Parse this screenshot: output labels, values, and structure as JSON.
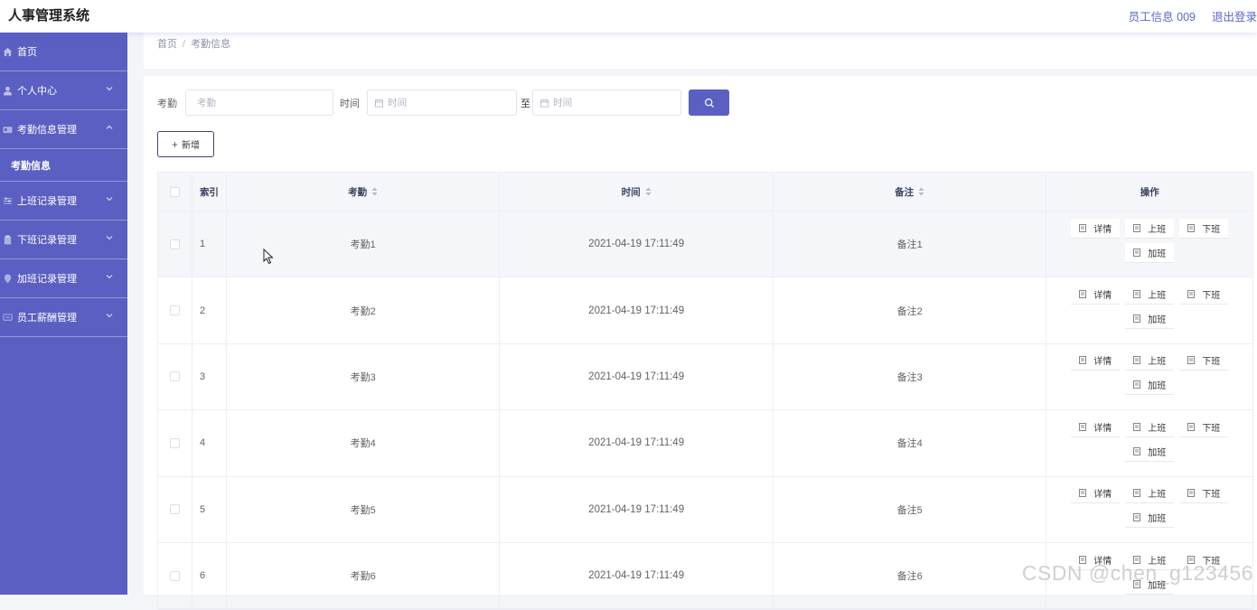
{
  "app": {
    "title": "人事管理系统",
    "user_label": "员工信息 009",
    "logout_label": "退出登录"
  },
  "sidebar": {
    "items": [
      {
        "label": "首页",
        "icon": "home-icon",
        "expandable": false
      },
      {
        "label": "个人中心",
        "icon": "user-icon",
        "expandable": true
      },
      {
        "label": "考勤信息管理",
        "icon": "card-icon",
        "expandable": true,
        "expanded": true,
        "children": [
          {
            "label": "考勤信息"
          }
        ]
      },
      {
        "label": "上班记录管理",
        "icon": "sliders-icon",
        "expandable": true
      },
      {
        "label": "下班记录管理",
        "icon": "clipboard-icon",
        "expandable": true
      },
      {
        "label": "加班记录管理",
        "icon": "pin-icon",
        "expandable": true
      },
      {
        "label": "员工薪酬管理",
        "icon": "message-icon",
        "expandable": true
      }
    ],
    "color": "#5b5fc2"
  },
  "breadcrumb": {
    "home": "首页",
    "separator": "/",
    "current": "考勤信息"
  },
  "search": {
    "attendance_label": "考勤",
    "attendance_placeholder": "考勤",
    "time_label": "时间",
    "time_start_placeholder": "时间",
    "to_label": "至",
    "time_end_placeholder": "时间",
    "search_icon": "search-icon"
  },
  "toolbar": {
    "add_label": "新增"
  },
  "table": {
    "headers": {
      "index": "索引",
      "attendance": "考勤",
      "time": "时间",
      "note": "备注",
      "actions": "操作"
    },
    "actions": {
      "detail": "详情",
      "clock_in": "上班",
      "clock_out": "下班",
      "overtime": "加班"
    },
    "rows": [
      {
        "index": "1",
        "attendance": "考勤1",
        "time": "2021-04-19 17:11:49",
        "note": "备注1"
      },
      {
        "index": "2",
        "attendance": "考勤2",
        "time": "2021-04-19 17:11:49",
        "note": "备注2"
      },
      {
        "index": "3",
        "attendance": "考勤3",
        "time": "2021-04-19 17:11:49",
        "note": "备注3"
      },
      {
        "index": "4",
        "attendance": "考勤4",
        "time": "2021-04-19 17:11:49",
        "note": "备注4"
      },
      {
        "index": "5",
        "attendance": "考勤5",
        "time": "2021-04-19 17:11:49",
        "note": "备注5"
      },
      {
        "index": "6",
        "attendance": "考勤6",
        "time": "2021-04-19 17:11:49",
        "note": "备注6"
      }
    ]
  },
  "watermark": "CSDN @chen_g123456",
  "colors": {
    "accent": "#5b5fc2",
    "accent_text": "#5a67c8"
  }
}
